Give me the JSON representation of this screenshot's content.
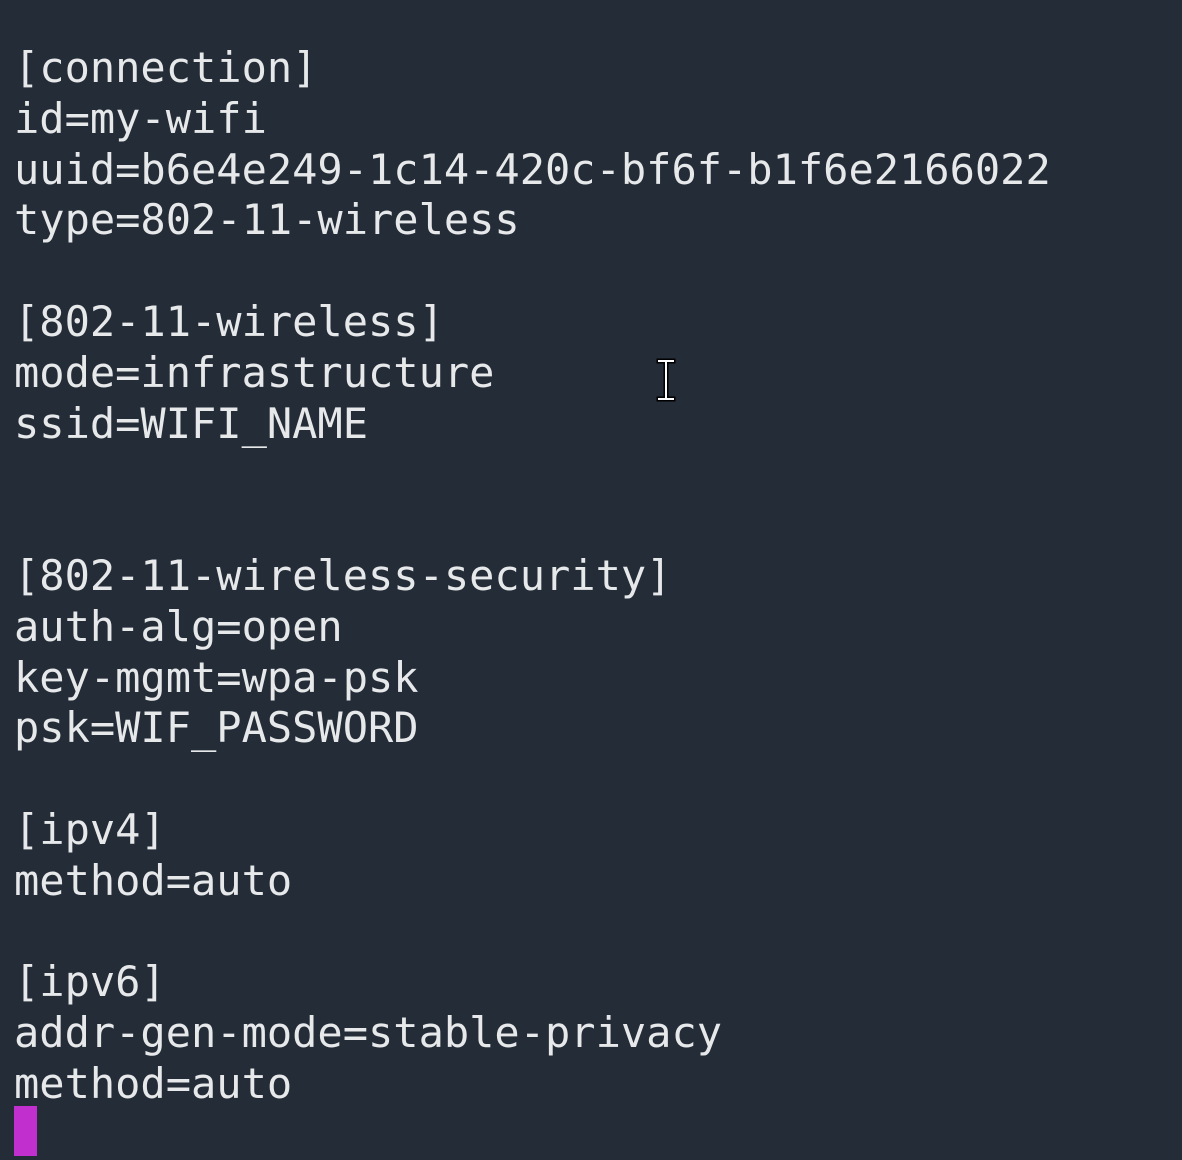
{
  "editor": {
    "lines": [
      "[connection]",
      "id=my-wifi",
      "uuid=b6e4e249-1c14-420c-bf6f-b1f6e2166022",
      "type=802-11-wireless",
      "",
      "[802-11-wireless]",
      "mode=infrastructure",
      "ssid=WIFI_NAME",
      "",
      "",
      "[802-11-wireless-security]",
      "auth-alg=open",
      "key-mgmt=wpa-psk",
      "psk=WIF_PASSWORD",
      "",
      "[ipv4]",
      "method=auto",
      "",
      "[ipv6]",
      "addr-gen-mode=stable-privacy",
      "method=auto"
    ]
  },
  "colors": {
    "background": "#232c37",
    "text": "#e6e8ea",
    "cursor": "#c22fcf"
  },
  "icons": {
    "mouse_pointer": "text-ibeam-icon"
  }
}
